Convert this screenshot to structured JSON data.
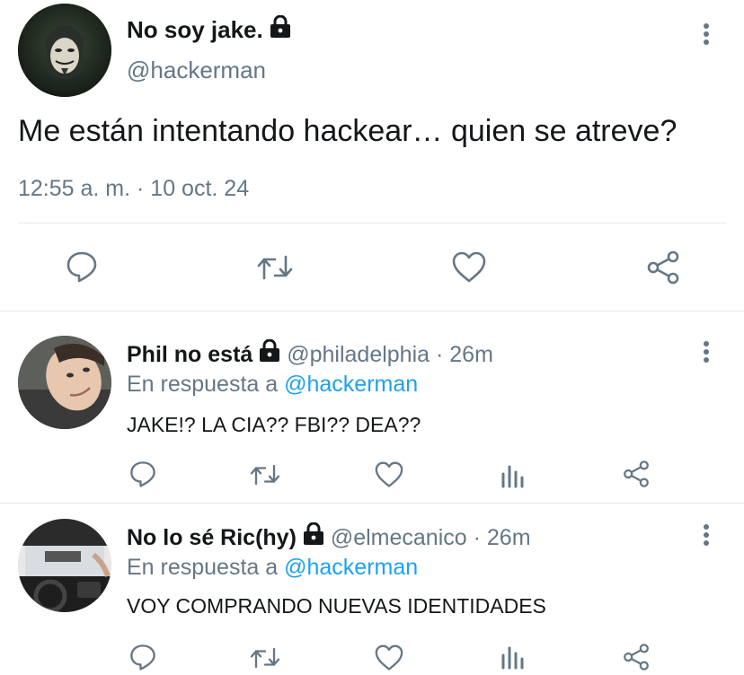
{
  "main_tweet": {
    "display_name": "No soy jake.",
    "handle": "@hackerman",
    "text": "Me están intentando hackear… quien se atreve?",
    "timestamp": "12:55 a. m. · 10 oct. 24",
    "avatar_icon": "anonymous-mask-avatar"
  },
  "replies": [
    {
      "display_name": "Phil no está",
      "handle": "@philadelphia",
      "time": "· 26m",
      "reply_prefix": "En respuesta a",
      "reply_to": "@hackerman",
      "text": "JAKE!? LA CIA?? FBI?? DEA??",
      "avatar_icon": "selfie-avatar"
    },
    {
      "display_name": "No lo sé Ric(hy)",
      "handle": "@elmecanico",
      "time": "· 26m",
      "reply_prefix": "En respuesta a",
      "reply_to": "@hackerman",
      "text": "VOY COMPRANDO NUEVAS IDENTIDADES",
      "avatar_icon": "car-interior-avatar"
    }
  ],
  "colors": {
    "text": "#14171a",
    "muted": "#657786",
    "link": "#1da1f2",
    "icon": "#657786",
    "divider": "#e1e8ed"
  }
}
